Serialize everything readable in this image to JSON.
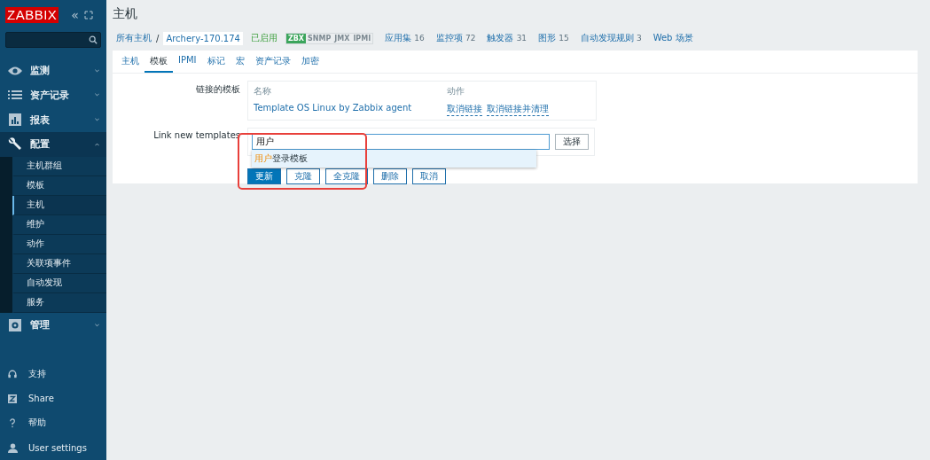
{
  "sidebar": {
    "logo": "ZABBIX",
    "collapse_icon": "«",
    "menu": [
      {
        "label": "监测",
        "expanded": false
      },
      {
        "label": "资产记录",
        "expanded": false
      },
      {
        "label": "报表",
        "expanded": false
      },
      {
        "label": "配置",
        "expanded": true,
        "children": [
          {
            "label": "主机群组",
            "selected": false
          },
          {
            "label": "模板",
            "selected": false
          },
          {
            "label": "主机",
            "selected": true
          },
          {
            "label": "维护",
            "selected": false
          },
          {
            "label": "动作",
            "selected": false
          },
          {
            "label": "关联项事件",
            "selected": false
          },
          {
            "label": "自动发现",
            "selected": false
          },
          {
            "label": "服务",
            "selected": false
          }
        ]
      },
      {
        "label": "管理",
        "expanded": false
      }
    ],
    "footer": [
      {
        "label": "支持"
      },
      {
        "label": "Share"
      },
      {
        "label": "帮助"
      },
      {
        "label": "User settings"
      }
    ]
  },
  "page_title": "主机",
  "breadcrumb": {
    "root": "所有主机",
    "separator": "/",
    "host": "Archery-170.174",
    "status": "已启用",
    "availability": [
      {
        "label": "ZBX",
        "on": true
      },
      {
        "label": "SNMP",
        "on": false
      },
      {
        "label": "JMX",
        "on": false
      },
      {
        "label": "IPMI",
        "on": false
      }
    ],
    "links": [
      {
        "label": "应用集",
        "count": "16"
      },
      {
        "label": "监控项",
        "count": "72"
      },
      {
        "label": "触发器",
        "count": "31"
      },
      {
        "label": "图形",
        "count": "15"
      },
      {
        "label": "自动发现规则",
        "count": "3"
      },
      {
        "label": "Web 场景"
      }
    ]
  },
  "tabs": [
    {
      "label": "主机",
      "selected": false
    },
    {
      "label": "模板",
      "selected": true
    },
    {
      "label": "IPMI",
      "selected": false
    },
    {
      "label": "标记",
      "selected": false
    },
    {
      "label": "宏",
      "selected": false
    },
    {
      "label": "资产记录",
      "selected": false
    },
    {
      "label": "加密",
      "selected": false
    }
  ],
  "linked_templates": {
    "label": "链接的模板",
    "columns": [
      "名称",
      "动作"
    ],
    "rows": [
      {
        "name": "Template OS Linux by Zabbix agent",
        "actions": [
          "取消链接",
          "取消链接并清理"
        ]
      }
    ]
  },
  "link_new": {
    "label": "Link new templates",
    "value": "用户",
    "select_button": "选择",
    "suggestions": [
      {
        "match": "用户",
        "rest": "登录模板"
      }
    ]
  },
  "buttons": [
    {
      "label": "更新",
      "primary": true
    },
    {
      "label": "克隆",
      "primary": false
    },
    {
      "label": "全克隆",
      "primary": false
    },
    {
      "label": "删除",
      "primary": false
    },
    {
      "label": "取消",
      "primary": false
    }
  ],
  "highlight": {
    "kind": "box",
    "color": "#e8403b"
  }
}
